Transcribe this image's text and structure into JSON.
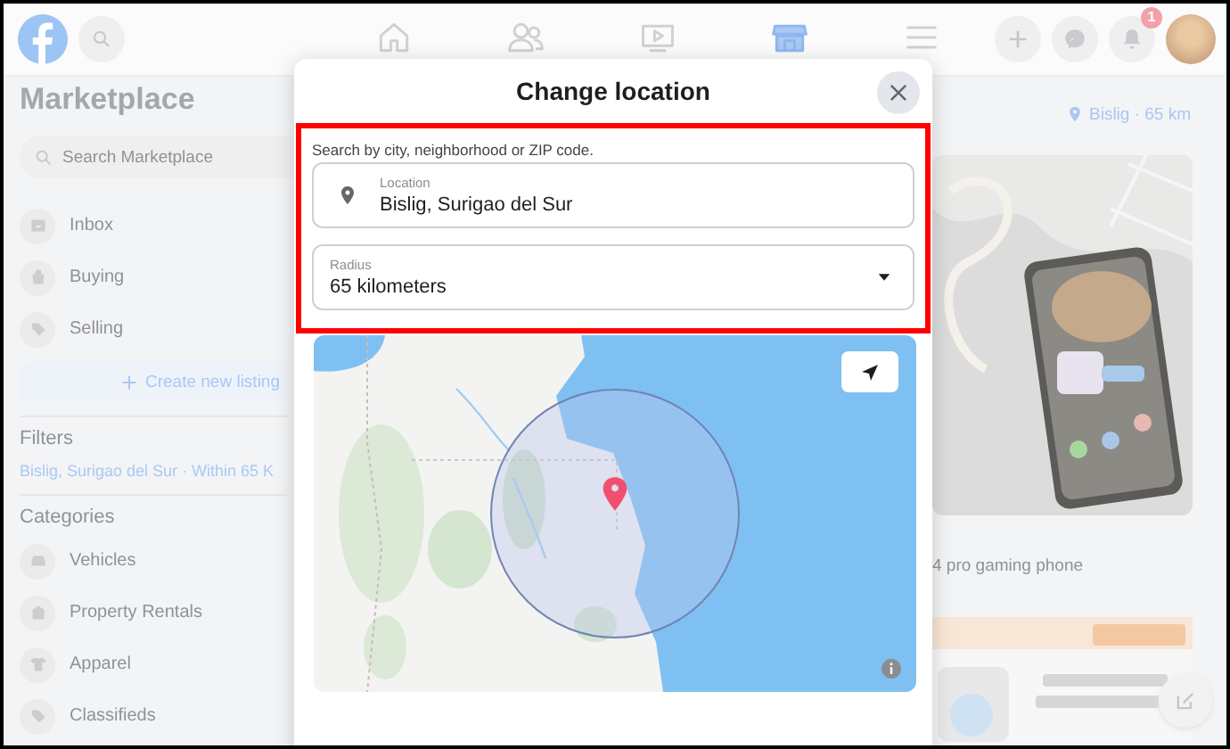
{
  "top_bar": {
    "nav": [
      {
        "kind": "home",
        "selected": false
      },
      {
        "kind": "friends",
        "selected": false
      },
      {
        "kind": "watch",
        "selected": false
      },
      {
        "kind": "marketplace",
        "selected": true
      },
      {
        "kind": "menu",
        "selected": false
      }
    ],
    "actions": [
      {
        "kind": "create"
      },
      {
        "kind": "messenger"
      },
      {
        "kind": "notifications",
        "badge": "1"
      }
    ]
  },
  "sidebar": {
    "title": "Marketplace",
    "search": {
      "placeholder": "Search Marketplace"
    },
    "items": [
      {
        "kind": "inbox",
        "label": "Inbox"
      },
      {
        "kind": "buying",
        "label": "Buying"
      },
      {
        "kind": "selling",
        "label": "Selling"
      }
    ],
    "create_button": "Create new listing",
    "filters_heading": "Filters",
    "filter_location": "Bislig, Surigao del Sur · Within 65 K",
    "categories_heading": "Categories",
    "categories": [
      {
        "kind": "vehicles",
        "label": "Vehicles"
      },
      {
        "kind": "rentals",
        "label": "Property Rentals"
      },
      {
        "kind": "apparel",
        "label": "Apparel"
      },
      {
        "kind": "selling",
        "label": "Classifieds"
      }
    ]
  },
  "feed": {
    "location": "Bislig · 65 km",
    "listing_title": "4 pro gaming phone"
  },
  "dialog": {
    "title": "Change location",
    "hint": "Search by city, neighborhood or ZIP code.",
    "location": {
      "label": "Location",
      "value": "Bislig, Surigao del Sur"
    },
    "radius": {
      "label": "Radius",
      "value": "65 kilometers"
    }
  }
}
